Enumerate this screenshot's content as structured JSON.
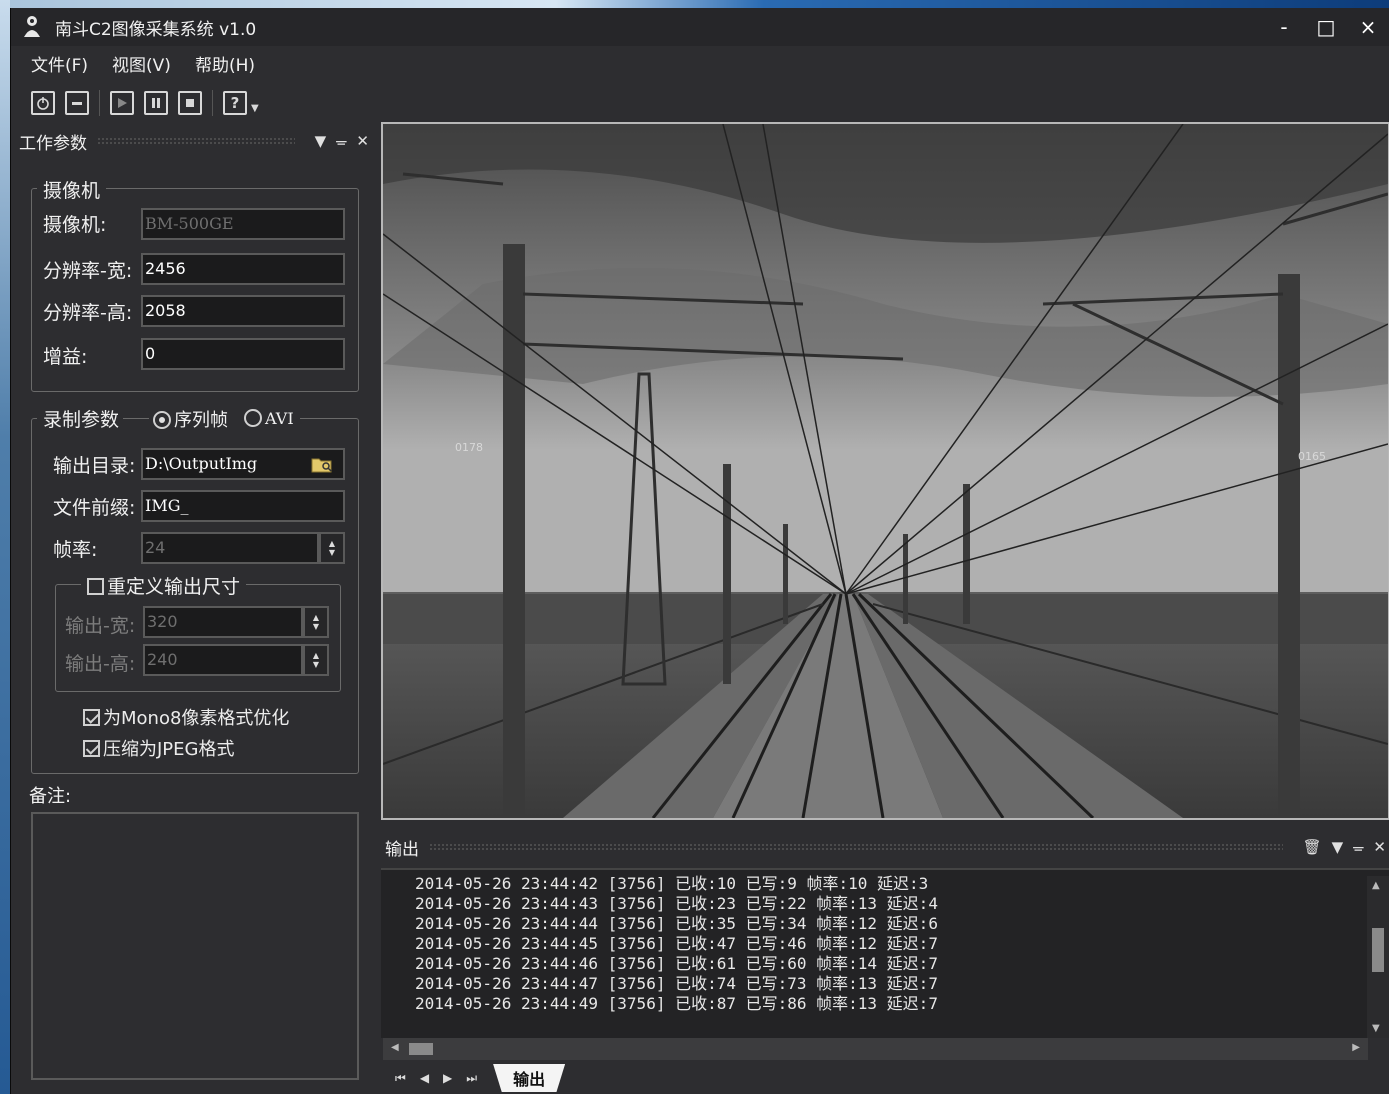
{
  "window": {
    "title": "南斗C2图像采集系统 v1.0",
    "minimize_label": "-",
    "maximize_label": "□",
    "close_label": "×"
  },
  "menu": {
    "file": "文件(F)",
    "view": "视图(V)",
    "help": "帮助(H)"
  },
  "toolbar": {
    "help_label": "?"
  },
  "params_panel": {
    "title": "工作参数",
    "camera_group": {
      "title": "摄像机",
      "camera_label": "摄像机:",
      "camera_value": "BM-500GE",
      "width_label": "分辨率-宽:",
      "width_value": "2456",
      "height_label": "分辨率-高:",
      "height_value": "2058",
      "gain_label": "增益:",
      "gain_value": "0"
    },
    "record_group": {
      "title": "录制参数",
      "radio_sequence": "序列帧",
      "radio_avi": "AVI",
      "output_dir_label": "输出目录:",
      "output_dir_value": "D:\\OutputImg",
      "prefix_label": "文件前缀:",
      "prefix_value": "IMG_",
      "fps_label": "帧率:",
      "fps_value": "24",
      "resize_group_title": "重定义输出尺寸",
      "out_width_label": "输出-宽:",
      "out_width_value": "320",
      "out_height_label": "输出-高:",
      "out_height_value": "240",
      "mono8_label": "为Mono8像素格式优化",
      "jpeg_label": "压缩为JPEG格式"
    },
    "notes_label": "备注:"
  },
  "image_overlay": {
    "pole_left_label": "0178",
    "pole_right_label": "0165"
  },
  "output_panel": {
    "title": "输出",
    "lines": [
      "2014-05-26 23:44:42 [3756] 已收:10 已写:9 帧率:10 延迟:3",
      "2014-05-26 23:44:43 [3756] 已收:23 已写:22 帧率:13 延迟:4",
      "2014-05-26 23:44:44 [3756] 已收:35 已写:34 帧率:12 延迟:6",
      "2014-05-26 23:44:45 [3756] 已收:47 已写:46 帧率:12 延迟:7",
      "2014-05-26 23:44:46 [3756] 已收:61 已写:60 帧率:14 延迟:7",
      "2014-05-26 23:44:47 [3756] 已收:74 已写:73 帧率:13 延迟:7",
      "2014-05-26 23:44:49 [3756] 已收:87 已写:86 帧率:13 延迟:7"
    ],
    "tab_label": "输出"
  }
}
